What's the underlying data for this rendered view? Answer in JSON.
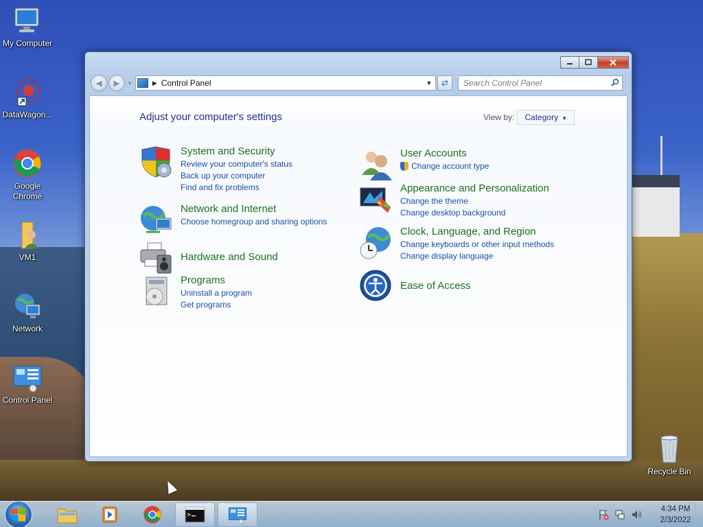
{
  "desktop": {
    "icons": [
      {
        "label": "My Computer"
      },
      {
        "label": "DataWagon..."
      },
      {
        "label": "Google Chrome"
      },
      {
        "label": "VM1"
      },
      {
        "label": "Network"
      },
      {
        "label": "Control Panel"
      },
      {
        "label": "Recycle Bin"
      }
    ]
  },
  "window": {
    "address": {
      "crumb": "Control Panel"
    },
    "search": {
      "placeholder": "Search Control Panel"
    },
    "title": "Adjust your computer's settings",
    "view_by": {
      "label": "View by:",
      "value": "Category"
    },
    "categories": [
      {
        "title": "System and Security",
        "links": [
          "Review your computer's status",
          "Back up your computer",
          "Find and fix problems"
        ]
      },
      {
        "title": "Network and Internet",
        "links": [
          "Choose homegroup and sharing options"
        ]
      },
      {
        "title": "Hardware and Sound",
        "links": []
      },
      {
        "title": "Programs",
        "links": [
          "Uninstall a program",
          "Get programs"
        ]
      },
      {
        "title": "User Accounts",
        "links": [
          "Change account type"
        ]
      },
      {
        "title": "Appearance and Personalization",
        "links": [
          "Change the theme",
          "Change desktop background"
        ]
      },
      {
        "title": "Clock, Language, and Region",
        "links": [
          "Change keyboards or other input methods",
          "Change display language"
        ]
      },
      {
        "title": "Ease of Access",
        "links": []
      }
    ]
  },
  "taskbar": {
    "clock": {
      "time": "4:34 PM",
      "date": "2/3/2022"
    }
  }
}
